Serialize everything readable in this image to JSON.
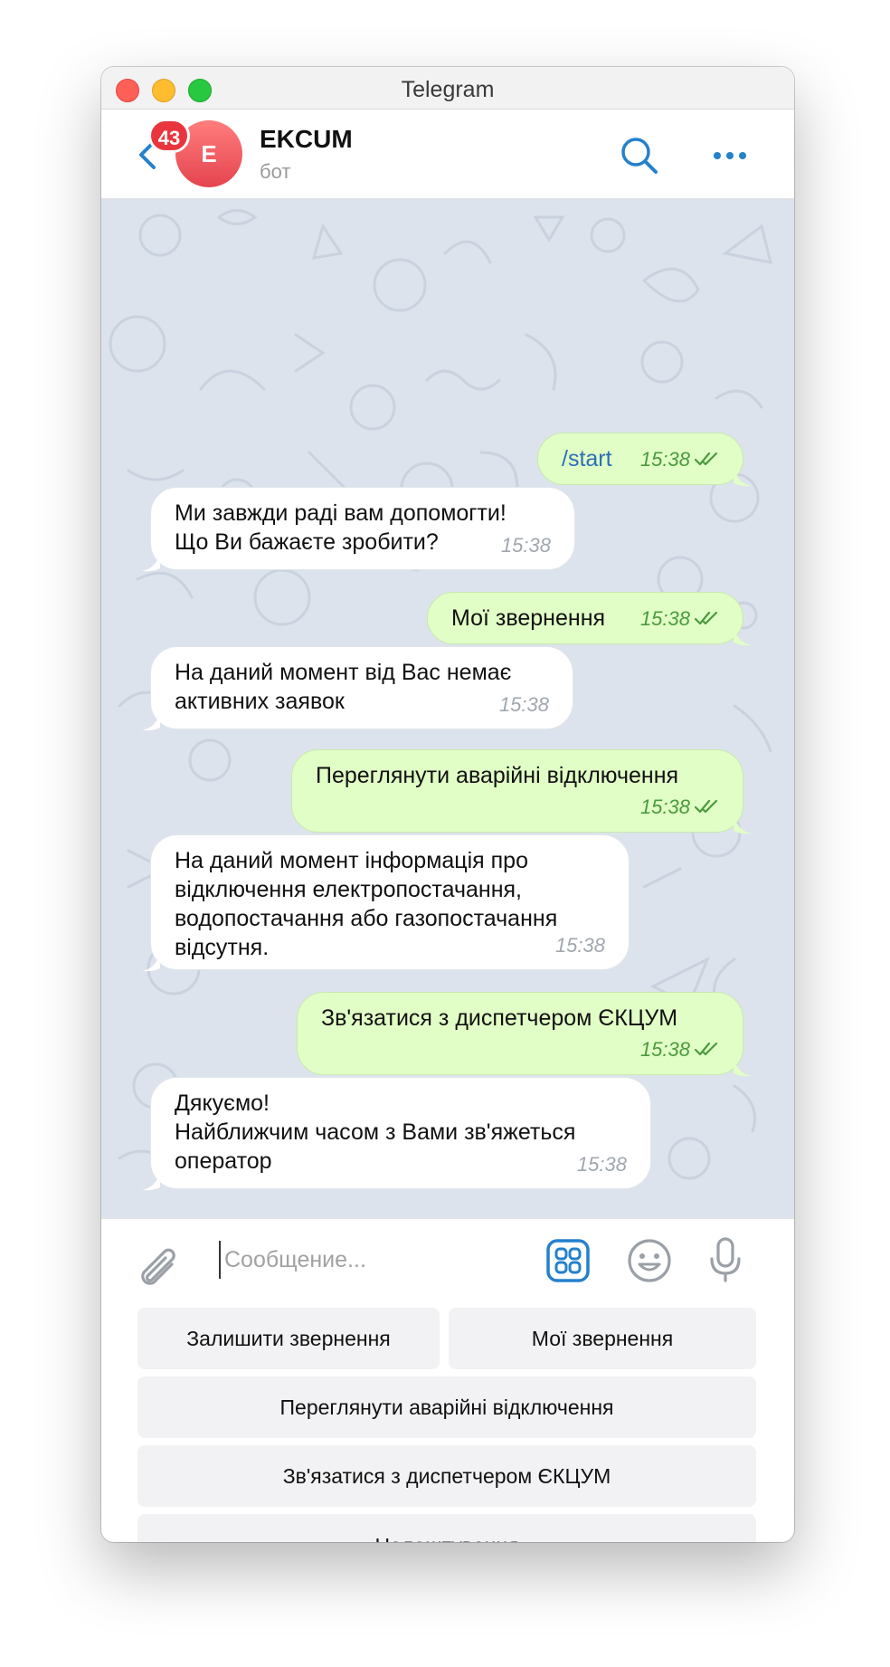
{
  "window": {
    "title": "Telegram"
  },
  "header": {
    "unread_count": "43",
    "avatar_letter": "E",
    "chat_name": "EKCUM",
    "chat_status": "бот"
  },
  "messages": [
    {
      "direction": "out",
      "text": "/start",
      "time": "15:38",
      "read": true
    },
    {
      "direction": "in",
      "text": "Ми завжди раді вам допомогти!\nЩо Ви бажаєте зробити?",
      "time": "15:38"
    },
    {
      "direction": "out",
      "text": "Мої звернення",
      "time": "15:38",
      "read": true
    },
    {
      "direction": "in",
      "text": "На даний момент від Вас немає\nактивних заявок",
      "time": "15:38"
    },
    {
      "direction": "out",
      "text": "Переглянути аварійні відключення",
      "time": "15:38",
      "read": true
    },
    {
      "direction": "in",
      "text": "На даний момент інформація про\nвідключення електропостачання,\nводопостачання або газопостачання\nвідсутня.",
      "time": "15:38"
    },
    {
      "direction": "out",
      "text": "Зв'язатися з диспетчером ЄКЦУМ",
      "time": "15:38",
      "read": true
    },
    {
      "direction": "in",
      "text": "Дякуємо!\nНайближчим часом з Вами зв'яжеться\nоператор",
      "time": "15:38"
    }
  ],
  "composer": {
    "placeholder": "Сообщение...",
    "icons": [
      "paperclip-icon",
      "bot-keyboard-icon",
      "emoji-icon",
      "microphone-icon"
    ]
  },
  "keyboard": {
    "buttons": [
      "Залишити звернення",
      "Мої звернення",
      "Переглянути аварійні відключення",
      "Зв'язатися з диспетчером ЄКЦУМ",
      "Налаштування"
    ]
  },
  "colors": {
    "accent": "#2481cc",
    "outgoing_bubble": "#e1fec6",
    "incoming_bubble": "#ffffff",
    "chat_background": "#dce3ec",
    "badge": "#e9363e",
    "read_ticks": "#4a9a3e"
  }
}
